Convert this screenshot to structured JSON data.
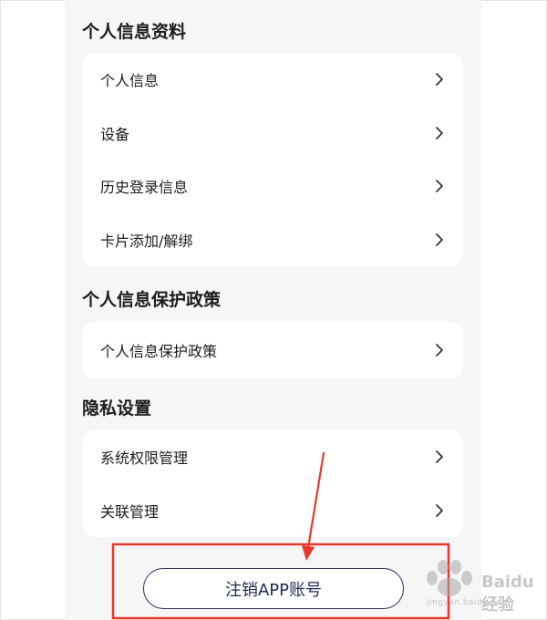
{
  "sections": [
    {
      "title": "个人信息资料",
      "items": [
        {
          "label": "个人信息"
        },
        {
          "label": "设备"
        },
        {
          "label": "历史登录信息"
        },
        {
          "label": "卡片添加/解绑"
        }
      ]
    },
    {
      "title": "个人信息保护政策",
      "items": [
        {
          "label": "个人信息保护政策"
        }
      ]
    },
    {
      "title": "隐私设置",
      "items": [
        {
          "label": "系统权限管理"
        },
        {
          "label": "关联管理"
        }
      ]
    }
  ],
  "cancel_account_button": "注销APP账号",
  "watermark": {
    "brand": "Baidu经验",
    "url": "jingyan.baidu.com"
  },
  "colors": {
    "background": "#f6f6f6",
    "card": "#ffffff",
    "text": "#1c1c1c",
    "button_border": "#2c3656",
    "annotation_red": "#e8372c"
  },
  "icons": {
    "row_chevron": "chevron-right-icon",
    "annotation_arrow": "arrow-down-icon"
  }
}
